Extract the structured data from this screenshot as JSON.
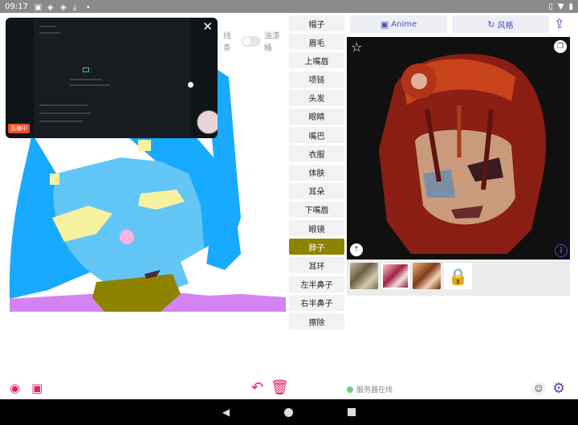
{
  "status_bar": {
    "time": "09:17"
  },
  "canvas": {
    "line_toggle_label": "线条",
    "paint_bucket_label": "油漆桶",
    "pip": {
      "live_badge": "直播中"
    }
  },
  "parts": [
    {
      "label": "帽子",
      "active": false
    },
    {
      "label": "眉毛",
      "active": false
    },
    {
      "label": "上嘴唇",
      "active": false
    },
    {
      "label": "项链",
      "active": false
    },
    {
      "label": "头发",
      "active": false
    },
    {
      "label": "眼睛",
      "active": false
    },
    {
      "label": "嘴巴",
      "active": false
    },
    {
      "label": "衣服",
      "active": false
    },
    {
      "label": "体肤",
      "active": false
    },
    {
      "label": "耳朵",
      "active": false
    },
    {
      "label": "下嘴唇",
      "active": false
    },
    {
      "label": "眼镜",
      "active": false
    },
    {
      "label": "脖子",
      "active": true
    },
    {
      "label": "耳环",
      "active": false
    },
    {
      "label": "左半鼻子",
      "active": false
    },
    {
      "label": "右半鼻子",
      "active": false
    },
    {
      "label": "擦除",
      "active": false
    }
  ],
  "toolbar": {
    "anime_label": "Anime",
    "style_label": "风格"
  },
  "server_status": "服务器在线",
  "colors": {
    "accent": "#4b4fbd",
    "active_part": "#8e8300",
    "tool_red": "#e0245e",
    "online_green": "#65d67b"
  },
  "icons": {
    "camera": "camera-icon",
    "gallery": "image-icon",
    "undo": "undo-icon",
    "trash": "trash-icon",
    "share": "share-icon",
    "star": "star-icon",
    "settings": "gear-icon"
  }
}
